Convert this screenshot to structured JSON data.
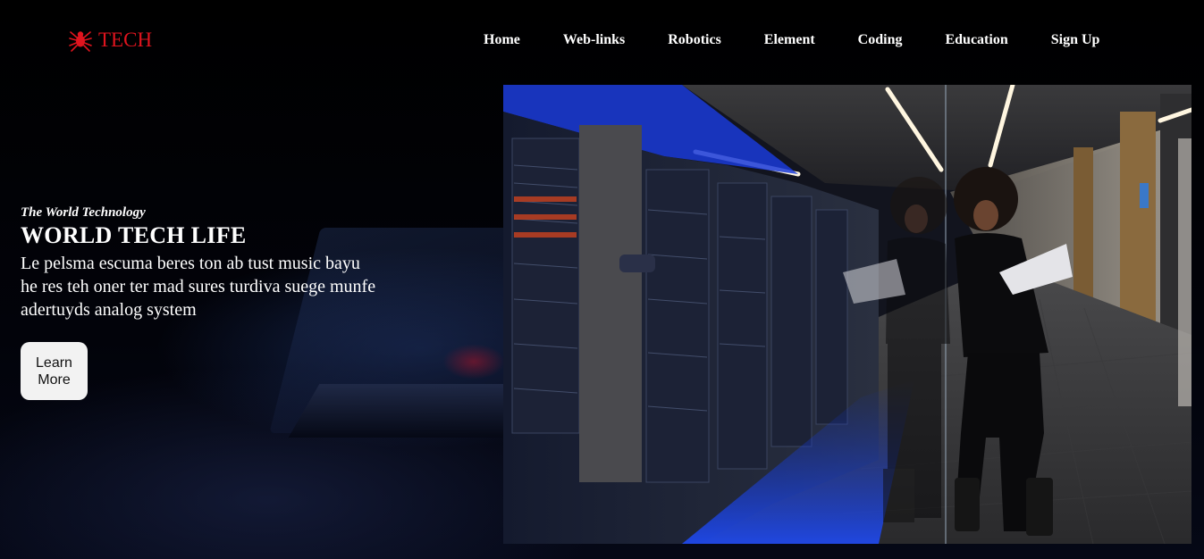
{
  "brand": {
    "logo_text": "TECH",
    "logo_icon": "spider-icon",
    "accent_color": "#e0141e"
  },
  "nav": {
    "items": [
      {
        "label": "Home"
      },
      {
        "label": "Web-links"
      },
      {
        "label": "Robotics"
      },
      {
        "label": "Element"
      },
      {
        "label": "Coding"
      },
      {
        "label": "Education"
      },
      {
        "label": "Sign Up"
      }
    ]
  },
  "hero": {
    "eyebrow": "The World Technology",
    "title": "WORLD TECH LIFE",
    "description": "Le pelsma escuma beres ton ab tust music bayu he res teh oner ter mad sures turdiva suege munfe adertuyds analog system",
    "cta_label": "Learn More"
  },
  "colors": {
    "background": "#000000",
    "text": "#ffffff",
    "button_bg": "#f2f2f2"
  }
}
